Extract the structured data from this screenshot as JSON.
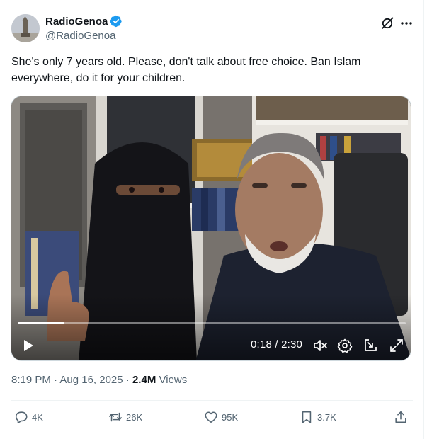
{
  "author": {
    "display_name": "RadioGenoa",
    "handle": "@RadioGenoa",
    "verified": true,
    "verified_color": "#1d9bf0"
  },
  "header_icons": [
    "grok-icon",
    "more-icon"
  ],
  "tweet": {
    "text": "She's only 7 years old. Please, don't talk about free choice. Ban Islam everywhere, do it for your children."
  },
  "video": {
    "elapsed": "0:18",
    "duration": "2:30",
    "time_display": "0:18 / 2:30",
    "progress_fraction": 0.12,
    "controls": [
      "play-icon",
      "mute-icon",
      "settings-icon",
      "popout-icon",
      "fullscreen-icon"
    ]
  },
  "meta": {
    "timestamp": "8:19 PM · Aug 16, 2025",
    "separator": "·",
    "views_count": "2.4M",
    "views_label": "Views"
  },
  "actions": {
    "replies": "4K",
    "reposts": "26K",
    "likes": "95K",
    "bookmarks": "3.7K"
  },
  "colors": {
    "text_primary": "#0f1419",
    "text_secondary": "#536471",
    "accent": "#1d9bf0",
    "border": "#eff3f4"
  }
}
